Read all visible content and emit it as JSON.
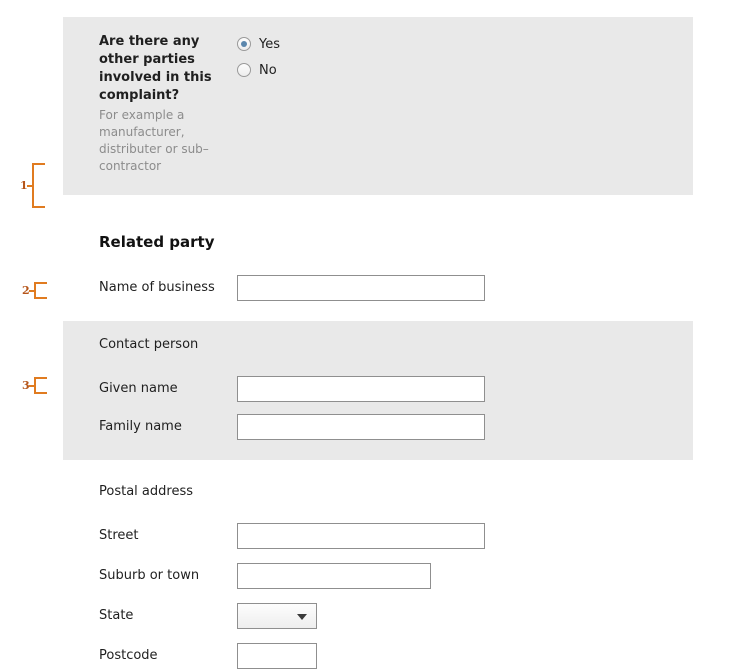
{
  "annotations": [
    {
      "number": "1"
    },
    {
      "number": "2"
    },
    {
      "number": "3"
    }
  ],
  "question_panel": {
    "question": "Are there any other parties involved in this complaint?",
    "hint": "For example a manufacturer, distributer or sub–contractor",
    "options": [
      {
        "label": "Yes",
        "selected": true
      },
      {
        "label": "No",
        "selected": false
      }
    ]
  },
  "related_party": {
    "heading": "Related party",
    "business": {
      "label": "Name of business",
      "value": "",
      "placeholder": ""
    }
  },
  "contact_person": {
    "heading": "Contact person",
    "fields": [
      {
        "label": "Given name",
        "value": "",
        "placeholder": ""
      },
      {
        "label": "Family name",
        "value": "",
        "placeholder": ""
      }
    ]
  },
  "postal_address": {
    "heading": "Postal address",
    "street": {
      "label": "Street",
      "value": "",
      "placeholder": ""
    },
    "suburb": {
      "label": "Suburb or town",
      "value": "",
      "placeholder": ""
    },
    "state": {
      "label": "State",
      "value": "",
      "caret": "chevron-down-icon"
    },
    "postcode": {
      "label": "Postcode",
      "value": "",
      "placeholder": ""
    }
  },
  "colors": {
    "panel_background": "#e9e9e9",
    "page_background": "#ffffff",
    "annotation": "#e07b20",
    "radio_selected": "#5b87ad",
    "hint_text": "#8c8c8c"
  }
}
